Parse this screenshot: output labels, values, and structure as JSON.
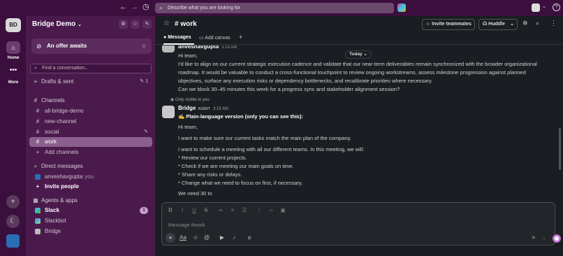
{
  "topbar": {
    "search_placeholder": "Describe what you are looking for",
    "back_icon": "←",
    "forward_icon": "→",
    "history_icon": "◷",
    "help_icon": "?"
  },
  "rail": {
    "workspace": "BD",
    "home_label": "Home",
    "more_label": "More"
  },
  "sidebar": {
    "workspace_name": "Bridge Demo",
    "offer": "An offer awaits",
    "find_placeholder": "Find a conversation...",
    "drafts": "Drafts & sent",
    "drafts_count": "1",
    "channels_header": "Channels",
    "channels": [
      "all-bridge-demo",
      "new-channel",
      "social",
      "work"
    ],
    "add_channels": "Add channels",
    "dm_header": "Direct messages",
    "dm_user": "anveshavgupta",
    "dm_you": "you",
    "invite_people": "Invite people",
    "agents_header": "Agents & apps",
    "apps": [
      "Slack",
      "Slackbot",
      "Bridge"
    ],
    "slack_badge": "1"
  },
  "channel": {
    "name": "# work",
    "tab_messages": "Messages",
    "tab_canvas": "Add canvas",
    "invite_btn": "Invite teammates",
    "huddle_btn": "Huddle"
  },
  "messages": {
    "first_author": "anveshavgupta",
    "first_time": "3:18 AM",
    "today": "Today",
    "m1": [
      "Hi team,",
      "I'd like to align on our current strategic execution cadence and validate that our near-term deliverables remain synchronized with the broader organizational",
      "roadmap. It would be valuable to conduct a cross-functional touchpoint to review ongoing workstreams, assess milestone progression against planned",
      "objectives, surface any execution risks or dependency bottlenecks, and recalibrate priorities where necessary.",
      "Can we block 30–45 minutes this week for a progress sync and stakeholder alignment session?"
    ],
    "visible_note": "Only visible to you",
    "bridge_author": "Bridge",
    "agent_tag": "AGENT",
    "bridge_time": "3:19 AM",
    "m2_title": "✍ Plain-language version (only you can see this):",
    "m2": [
      "Hi team,",
      "I want to make sure our current tasks match the main plan of the company.",
      "I want to schedule a meeting with all our different teams. In this meeting, we will:",
      "* Review our current projects.",
      "* Check if we are meeting our main goals on time.",
      "* Share any risks or delays.",
      "* Change what we need to focus on first, if necessary.",
      "We need 30 to"
    ]
  },
  "composer": {
    "placeholder": "Message #work"
  }
}
